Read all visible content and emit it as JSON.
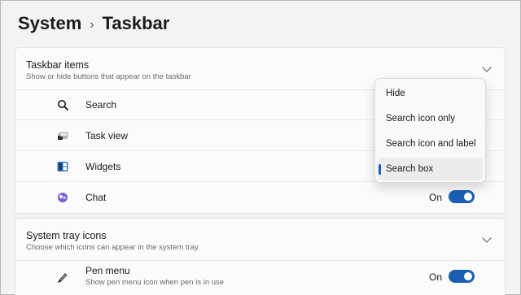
{
  "breadcrumb": {
    "parent": "System",
    "separator": "›",
    "current": "Taskbar"
  },
  "taskbar_items": {
    "title": "Taskbar items",
    "subtitle": "Show or hide buttons that appear on the taskbar",
    "rows": [
      {
        "label": "Search",
        "icon": "search-icon"
      },
      {
        "label": "Task view",
        "icon": "task-view-icon"
      },
      {
        "label": "Widgets",
        "icon": "widgets-icon"
      },
      {
        "label": "Chat",
        "icon": "chat-icon",
        "state": "On",
        "toggle_on": true
      }
    ]
  },
  "search_flyout": {
    "options": [
      "Hide",
      "Search icon only",
      "Search icon and label",
      "Search box"
    ],
    "selected": "Search box"
  },
  "system_tray": {
    "title": "System tray icons",
    "subtitle": "Choose which icons can appear in the system tray",
    "rows": [
      {
        "label": "Pen menu",
        "desc": "Show pen menu icon when pen is in use",
        "icon": "pen-icon",
        "state": "On",
        "toggle_on": true
      }
    ]
  },
  "colors": {
    "accent": "#1a5fb4",
    "background": "#f3f3f3",
    "card": "#fbfbfb"
  }
}
